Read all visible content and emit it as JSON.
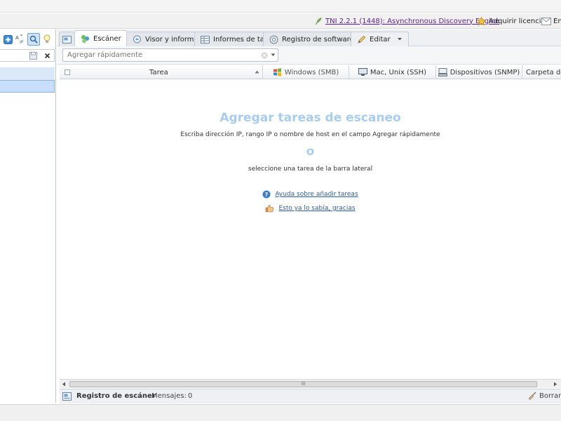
{
  "topbar": {
    "version_link": "TNI 2.2.1 (1448): Asynchronous Discovery Engine",
    "license_label": "Adquirir licencia",
    "mail_label": "En"
  },
  "tabs": [
    {
      "label": "Escáner",
      "icon": "scanner-icon",
      "active": true
    },
    {
      "label": "Visor y informes",
      "icon": "viewer-icon"
    },
    {
      "label": "Informes de tabla",
      "icon": "table-icon"
    },
    {
      "label": "Registro de software",
      "icon": "software-icon"
    },
    {
      "label": "Editar",
      "icon": "pencil-icon"
    }
  ],
  "quick_add": {
    "placeholder": "Agregar rápidamente"
  },
  "columns": [
    {
      "label": "Tarea"
    },
    {
      "label": "Windows (SMB)",
      "icon": "windows-icon"
    },
    {
      "label": "Mac, Unix (SSH)",
      "icon": "monitor-icon"
    },
    {
      "label": "Dispositivos (SNMP)",
      "icon": "device-icon"
    },
    {
      "label": "Carpeta de",
      "icon": "folder-icon"
    }
  ],
  "empty_state": {
    "title": "Agregar tareas de escaneo",
    "line1": "Escriba dirección IP, rango IP o nombre de host en el campo Agregar rápidamente",
    "or": "o",
    "line2": "seleccione una tarea de la barra lateral",
    "help_link": "Ayuda sobre añadir tareas",
    "dismiss_link": "Esto ya lo sabía, gracias"
  },
  "hscroll": {
    "grip": "III"
  },
  "statusbar": {
    "title": "Registro de escáner",
    "messages_label": "Mensajes:",
    "messages_count": "0",
    "clear_label": "Borrar"
  },
  "colors": {
    "accent": "#a9cdef",
    "link": "#2f5d9c",
    "version_link": "#5a1f8c"
  }
}
